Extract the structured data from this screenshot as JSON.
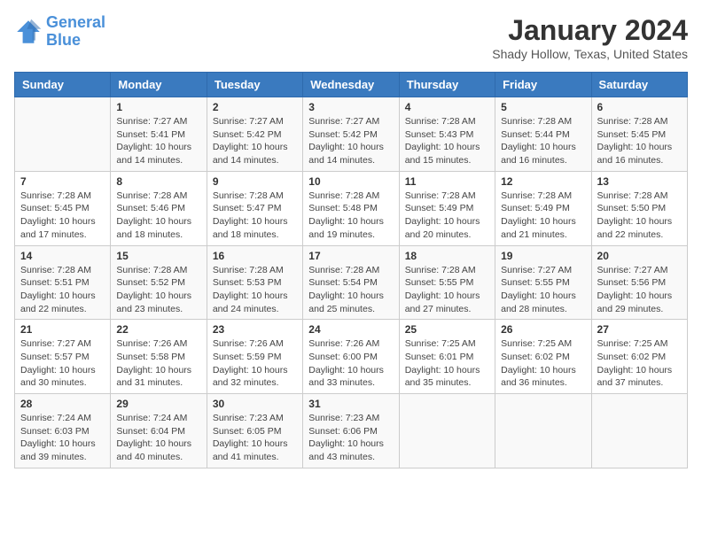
{
  "header": {
    "logo_line1": "General",
    "logo_line2": "Blue",
    "title": "January 2024",
    "subtitle": "Shady Hollow, Texas, United States"
  },
  "days_of_week": [
    "Sunday",
    "Monday",
    "Tuesday",
    "Wednesday",
    "Thursday",
    "Friday",
    "Saturday"
  ],
  "weeks": [
    [
      {
        "day": "",
        "info": ""
      },
      {
        "day": "1",
        "info": "Sunrise: 7:27 AM\nSunset: 5:41 PM\nDaylight: 10 hours\nand 14 minutes."
      },
      {
        "day": "2",
        "info": "Sunrise: 7:27 AM\nSunset: 5:42 PM\nDaylight: 10 hours\nand 14 minutes."
      },
      {
        "day": "3",
        "info": "Sunrise: 7:27 AM\nSunset: 5:42 PM\nDaylight: 10 hours\nand 14 minutes."
      },
      {
        "day": "4",
        "info": "Sunrise: 7:28 AM\nSunset: 5:43 PM\nDaylight: 10 hours\nand 15 minutes."
      },
      {
        "day": "5",
        "info": "Sunrise: 7:28 AM\nSunset: 5:44 PM\nDaylight: 10 hours\nand 16 minutes."
      },
      {
        "day": "6",
        "info": "Sunrise: 7:28 AM\nSunset: 5:45 PM\nDaylight: 10 hours\nand 16 minutes."
      }
    ],
    [
      {
        "day": "7",
        "info": "Sunrise: 7:28 AM\nSunset: 5:45 PM\nDaylight: 10 hours\nand 17 minutes."
      },
      {
        "day": "8",
        "info": "Sunrise: 7:28 AM\nSunset: 5:46 PM\nDaylight: 10 hours\nand 18 minutes."
      },
      {
        "day": "9",
        "info": "Sunrise: 7:28 AM\nSunset: 5:47 PM\nDaylight: 10 hours\nand 18 minutes."
      },
      {
        "day": "10",
        "info": "Sunrise: 7:28 AM\nSunset: 5:48 PM\nDaylight: 10 hours\nand 19 minutes."
      },
      {
        "day": "11",
        "info": "Sunrise: 7:28 AM\nSunset: 5:49 PM\nDaylight: 10 hours\nand 20 minutes."
      },
      {
        "day": "12",
        "info": "Sunrise: 7:28 AM\nSunset: 5:49 PM\nDaylight: 10 hours\nand 21 minutes."
      },
      {
        "day": "13",
        "info": "Sunrise: 7:28 AM\nSunset: 5:50 PM\nDaylight: 10 hours\nand 22 minutes."
      }
    ],
    [
      {
        "day": "14",
        "info": "Sunrise: 7:28 AM\nSunset: 5:51 PM\nDaylight: 10 hours\nand 22 minutes."
      },
      {
        "day": "15",
        "info": "Sunrise: 7:28 AM\nSunset: 5:52 PM\nDaylight: 10 hours\nand 23 minutes."
      },
      {
        "day": "16",
        "info": "Sunrise: 7:28 AM\nSunset: 5:53 PM\nDaylight: 10 hours\nand 24 minutes."
      },
      {
        "day": "17",
        "info": "Sunrise: 7:28 AM\nSunset: 5:54 PM\nDaylight: 10 hours\nand 25 minutes."
      },
      {
        "day": "18",
        "info": "Sunrise: 7:28 AM\nSunset: 5:55 PM\nDaylight: 10 hours\nand 27 minutes."
      },
      {
        "day": "19",
        "info": "Sunrise: 7:27 AM\nSunset: 5:55 PM\nDaylight: 10 hours\nand 28 minutes."
      },
      {
        "day": "20",
        "info": "Sunrise: 7:27 AM\nSunset: 5:56 PM\nDaylight: 10 hours\nand 29 minutes."
      }
    ],
    [
      {
        "day": "21",
        "info": "Sunrise: 7:27 AM\nSunset: 5:57 PM\nDaylight: 10 hours\nand 30 minutes."
      },
      {
        "day": "22",
        "info": "Sunrise: 7:26 AM\nSunset: 5:58 PM\nDaylight: 10 hours\nand 31 minutes."
      },
      {
        "day": "23",
        "info": "Sunrise: 7:26 AM\nSunset: 5:59 PM\nDaylight: 10 hours\nand 32 minutes."
      },
      {
        "day": "24",
        "info": "Sunrise: 7:26 AM\nSunset: 6:00 PM\nDaylight: 10 hours\nand 33 minutes."
      },
      {
        "day": "25",
        "info": "Sunrise: 7:25 AM\nSunset: 6:01 PM\nDaylight: 10 hours\nand 35 minutes."
      },
      {
        "day": "26",
        "info": "Sunrise: 7:25 AM\nSunset: 6:02 PM\nDaylight: 10 hours\nand 36 minutes."
      },
      {
        "day": "27",
        "info": "Sunrise: 7:25 AM\nSunset: 6:02 PM\nDaylight: 10 hours\nand 37 minutes."
      }
    ],
    [
      {
        "day": "28",
        "info": "Sunrise: 7:24 AM\nSunset: 6:03 PM\nDaylight: 10 hours\nand 39 minutes."
      },
      {
        "day": "29",
        "info": "Sunrise: 7:24 AM\nSunset: 6:04 PM\nDaylight: 10 hours\nand 40 minutes."
      },
      {
        "day": "30",
        "info": "Sunrise: 7:23 AM\nSunset: 6:05 PM\nDaylight: 10 hours\nand 41 minutes."
      },
      {
        "day": "31",
        "info": "Sunrise: 7:23 AM\nSunset: 6:06 PM\nDaylight: 10 hours\nand 43 minutes."
      },
      {
        "day": "",
        "info": ""
      },
      {
        "day": "",
        "info": ""
      },
      {
        "day": "",
        "info": ""
      }
    ]
  ]
}
